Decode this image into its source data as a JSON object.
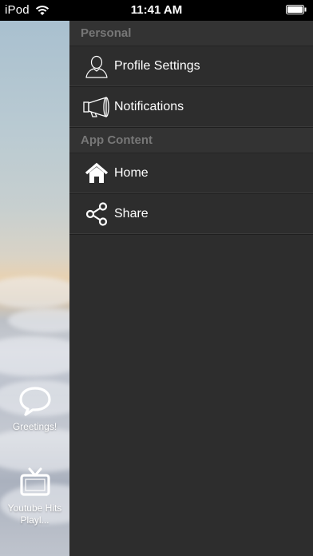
{
  "status_bar": {
    "carrier": "iPod",
    "time": "11:41 AM"
  },
  "menu": {
    "sections": [
      {
        "header": "Personal",
        "items": [
          {
            "label": "Profile Settings",
            "icon": "person-icon"
          },
          {
            "label": "Notifications",
            "icon": "megaphone-icon"
          }
        ]
      },
      {
        "header": "App Content",
        "items": [
          {
            "label": "Home",
            "icon": "home-icon"
          },
          {
            "label": "Share",
            "icon": "share-icon"
          }
        ]
      }
    ]
  },
  "background_tabs": [
    {
      "label": "Greetings!",
      "icon": "speech-bubble-icon"
    },
    {
      "label": "Youtube Hits Playl...",
      "icon": "tv-icon"
    }
  ],
  "colors": {
    "menu_bg": "#2d2d2d",
    "section_header_text": "#777777",
    "menu_text": "#ffffff",
    "status_bar_bg": "#000000"
  }
}
